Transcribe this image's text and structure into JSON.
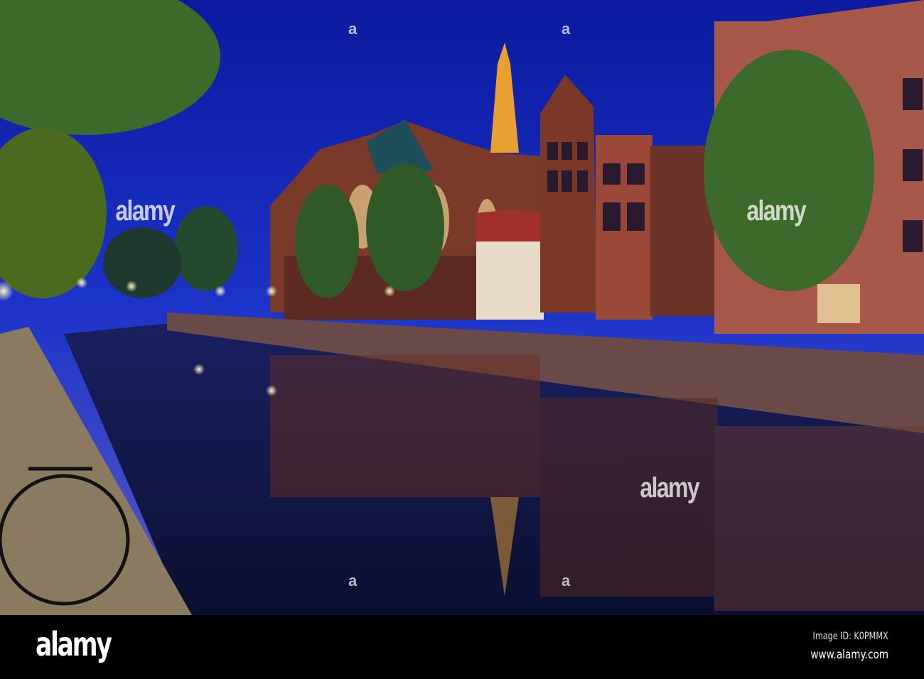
{
  "photo": {
    "subject": "Amsterdam canal at night with Oude Kerk church",
    "watermark_text": "alamy",
    "watermark_mark": "a"
  },
  "footer": {
    "logo": "alamy",
    "image_id": "Image ID: K0PMMX",
    "url": "www.alamy.com"
  }
}
